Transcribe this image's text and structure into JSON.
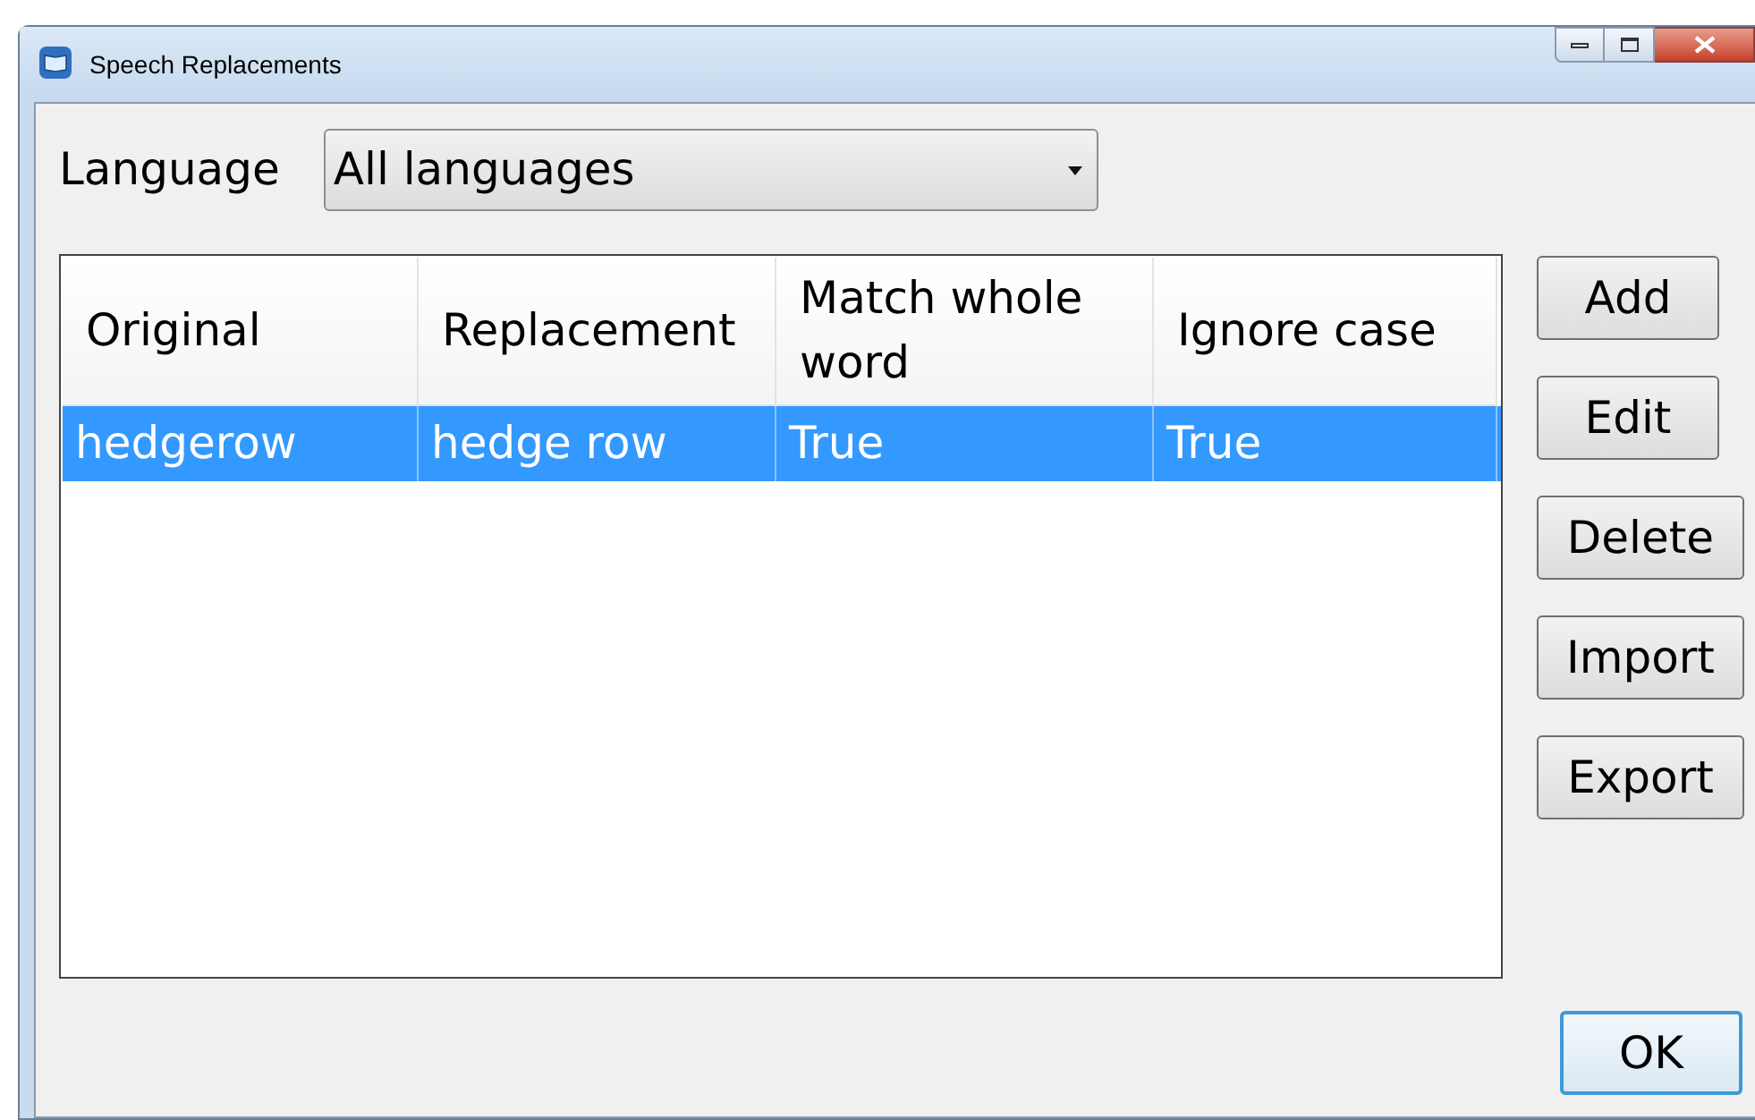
{
  "window": {
    "title": "Speech Replacements"
  },
  "language": {
    "label": "Language",
    "value": "All languages"
  },
  "table": {
    "columns": [
      {
        "label": "Original"
      },
      {
        "label": "Replacement"
      },
      {
        "label": "Match whole word"
      },
      {
        "label": "Ignore case"
      }
    ],
    "rows": [
      {
        "cells": [
          "hedgerow",
          "hedge row",
          "True",
          "True"
        ],
        "selected": true
      }
    ]
  },
  "side_buttons": [
    "Add",
    "Edit",
    "Delete",
    "Import",
    "Export"
  ],
  "ok_button": "OK"
}
